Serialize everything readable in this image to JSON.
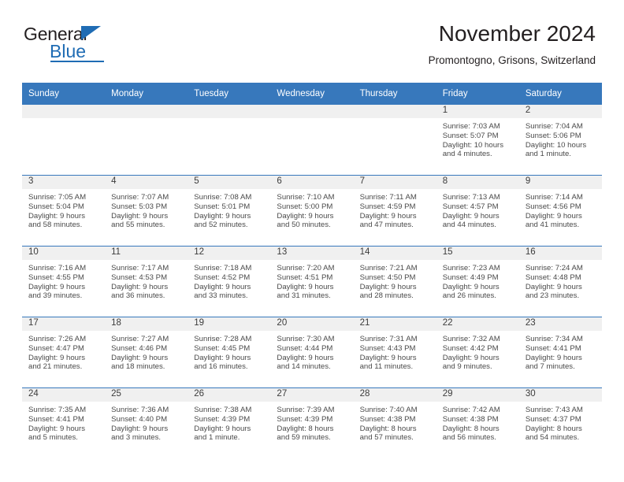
{
  "brand": {
    "name_part1": "General",
    "name_part2": "Blue"
  },
  "header": {
    "title": "November 2024",
    "subtitle": "Promontogno, Grisons, Switzerland"
  },
  "colors": {
    "accent_blue": "#3778bc",
    "logo_blue": "#1f6cb4",
    "daynum_band": "#f0f0f0",
    "text": "#231f20"
  },
  "weekdays": [
    "Sunday",
    "Monday",
    "Tuesday",
    "Wednesday",
    "Thursday",
    "Friday",
    "Saturday"
  ],
  "weeks": [
    [
      {
        "day": "",
        "lines": []
      },
      {
        "day": "",
        "lines": []
      },
      {
        "day": "",
        "lines": []
      },
      {
        "day": "",
        "lines": []
      },
      {
        "day": "",
        "lines": []
      },
      {
        "day": "1",
        "lines": [
          "Sunrise: 7:03 AM",
          "Sunset: 5:07 PM",
          "Daylight: 10 hours",
          "and 4 minutes."
        ]
      },
      {
        "day": "2",
        "lines": [
          "Sunrise: 7:04 AM",
          "Sunset: 5:06 PM",
          "Daylight: 10 hours",
          "and 1 minute."
        ]
      }
    ],
    [
      {
        "day": "3",
        "lines": [
          "Sunrise: 7:05 AM",
          "Sunset: 5:04 PM",
          "Daylight: 9 hours",
          "and 58 minutes."
        ]
      },
      {
        "day": "4",
        "lines": [
          "Sunrise: 7:07 AM",
          "Sunset: 5:03 PM",
          "Daylight: 9 hours",
          "and 55 minutes."
        ]
      },
      {
        "day": "5",
        "lines": [
          "Sunrise: 7:08 AM",
          "Sunset: 5:01 PM",
          "Daylight: 9 hours",
          "and 52 minutes."
        ]
      },
      {
        "day": "6",
        "lines": [
          "Sunrise: 7:10 AM",
          "Sunset: 5:00 PM",
          "Daylight: 9 hours",
          "and 50 minutes."
        ]
      },
      {
        "day": "7",
        "lines": [
          "Sunrise: 7:11 AM",
          "Sunset: 4:59 PM",
          "Daylight: 9 hours",
          "and 47 minutes."
        ]
      },
      {
        "day": "8",
        "lines": [
          "Sunrise: 7:13 AM",
          "Sunset: 4:57 PM",
          "Daylight: 9 hours",
          "and 44 minutes."
        ]
      },
      {
        "day": "9",
        "lines": [
          "Sunrise: 7:14 AM",
          "Sunset: 4:56 PM",
          "Daylight: 9 hours",
          "and 41 minutes."
        ]
      }
    ],
    [
      {
        "day": "10",
        "lines": [
          "Sunrise: 7:16 AM",
          "Sunset: 4:55 PM",
          "Daylight: 9 hours",
          "and 39 minutes."
        ]
      },
      {
        "day": "11",
        "lines": [
          "Sunrise: 7:17 AM",
          "Sunset: 4:53 PM",
          "Daylight: 9 hours",
          "and 36 minutes."
        ]
      },
      {
        "day": "12",
        "lines": [
          "Sunrise: 7:18 AM",
          "Sunset: 4:52 PM",
          "Daylight: 9 hours",
          "and 33 minutes."
        ]
      },
      {
        "day": "13",
        "lines": [
          "Sunrise: 7:20 AM",
          "Sunset: 4:51 PM",
          "Daylight: 9 hours",
          "and 31 minutes."
        ]
      },
      {
        "day": "14",
        "lines": [
          "Sunrise: 7:21 AM",
          "Sunset: 4:50 PM",
          "Daylight: 9 hours",
          "and 28 minutes."
        ]
      },
      {
        "day": "15",
        "lines": [
          "Sunrise: 7:23 AM",
          "Sunset: 4:49 PM",
          "Daylight: 9 hours",
          "and 26 minutes."
        ]
      },
      {
        "day": "16",
        "lines": [
          "Sunrise: 7:24 AM",
          "Sunset: 4:48 PM",
          "Daylight: 9 hours",
          "and 23 minutes."
        ]
      }
    ],
    [
      {
        "day": "17",
        "lines": [
          "Sunrise: 7:26 AM",
          "Sunset: 4:47 PM",
          "Daylight: 9 hours",
          "and 21 minutes."
        ]
      },
      {
        "day": "18",
        "lines": [
          "Sunrise: 7:27 AM",
          "Sunset: 4:46 PM",
          "Daylight: 9 hours",
          "and 18 minutes."
        ]
      },
      {
        "day": "19",
        "lines": [
          "Sunrise: 7:28 AM",
          "Sunset: 4:45 PM",
          "Daylight: 9 hours",
          "and 16 minutes."
        ]
      },
      {
        "day": "20",
        "lines": [
          "Sunrise: 7:30 AM",
          "Sunset: 4:44 PM",
          "Daylight: 9 hours",
          "and 14 minutes."
        ]
      },
      {
        "day": "21",
        "lines": [
          "Sunrise: 7:31 AM",
          "Sunset: 4:43 PM",
          "Daylight: 9 hours",
          "and 11 minutes."
        ]
      },
      {
        "day": "22",
        "lines": [
          "Sunrise: 7:32 AM",
          "Sunset: 4:42 PM",
          "Daylight: 9 hours",
          "and 9 minutes."
        ]
      },
      {
        "day": "23",
        "lines": [
          "Sunrise: 7:34 AM",
          "Sunset: 4:41 PM",
          "Daylight: 9 hours",
          "and 7 minutes."
        ]
      }
    ],
    [
      {
        "day": "24",
        "lines": [
          "Sunrise: 7:35 AM",
          "Sunset: 4:41 PM",
          "Daylight: 9 hours",
          "and 5 minutes."
        ]
      },
      {
        "day": "25",
        "lines": [
          "Sunrise: 7:36 AM",
          "Sunset: 4:40 PM",
          "Daylight: 9 hours",
          "and 3 minutes."
        ]
      },
      {
        "day": "26",
        "lines": [
          "Sunrise: 7:38 AM",
          "Sunset: 4:39 PM",
          "Daylight: 9 hours",
          "and 1 minute."
        ]
      },
      {
        "day": "27",
        "lines": [
          "Sunrise: 7:39 AM",
          "Sunset: 4:39 PM",
          "Daylight: 8 hours",
          "and 59 minutes."
        ]
      },
      {
        "day": "28",
        "lines": [
          "Sunrise: 7:40 AM",
          "Sunset: 4:38 PM",
          "Daylight: 8 hours",
          "and 57 minutes."
        ]
      },
      {
        "day": "29",
        "lines": [
          "Sunrise: 7:42 AM",
          "Sunset: 4:38 PM",
          "Daylight: 8 hours",
          "and 56 minutes."
        ]
      },
      {
        "day": "30",
        "lines": [
          "Sunrise: 7:43 AM",
          "Sunset: 4:37 PM",
          "Daylight: 8 hours",
          "and 54 minutes."
        ]
      }
    ]
  ]
}
